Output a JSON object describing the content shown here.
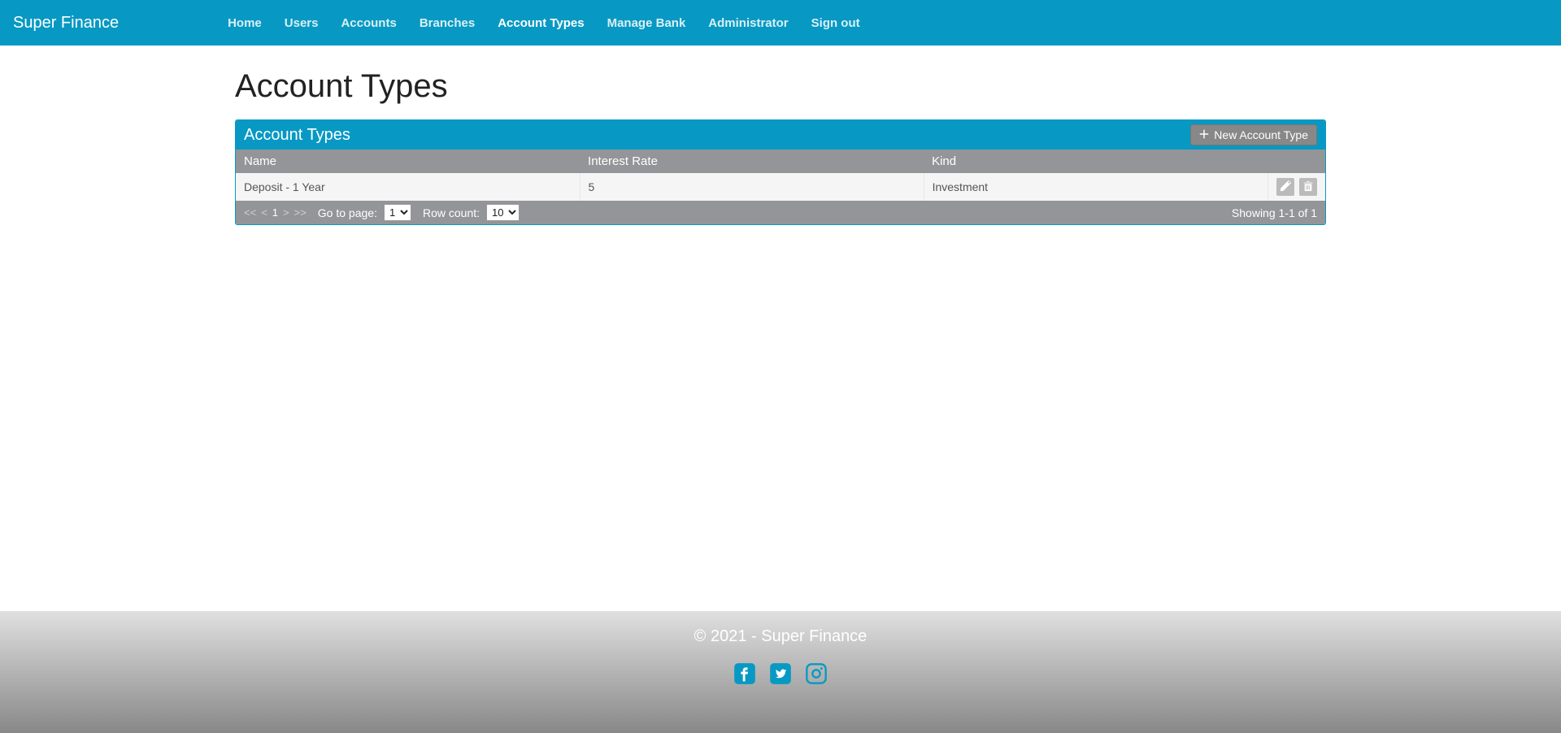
{
  "brand": "Super Finance",
  "nav": {
    "items": [
      {
        "label": "Home",
        "active": false
      },
      {
        "label": "Users",
        "active": false
      },
      {
        "label": "Accounts",
        "active": false
      },
      {
        "label": "Branches",
        "active": false
      },
      {
        "label": "Account Types",
        "active": true
      },
      {
        "label": "Manage Bank",
        "active": false
      },
      {
        "label": "Administrator",
        "active": false
      },
      {
        "label": "Sign out",
        "active": false
      }
    ]
  },
  "page": {
    "title": "Account Types"
  },
  "panel": {
    "title": "Account Types",
    "new_button": "New Account Type"
  },
  "table": {
    "columns": [
      "Name",
      "Interest Rate",
      "Kind"
    ],
    "rows": [
      {
        "name": "Deposit - 1 Year",
        "interest_rate": "5",
        "kind": "Investment"
      }
    ]
  },
  "pager": {
    "first": "<<",
    "prev": "<",
    "current": "1",
    "next": ">",
    "last": ">>",
    "goto_label": "Go to page:",
    "goto_value": "1",
    "rowcount_label": "Row count:",
    "rowcount_value": "10",
    "summary": "Showing 1-1 of 1"
  },
  "footer": {
    "text": "© 2021 - Super Finance"
  }
}
